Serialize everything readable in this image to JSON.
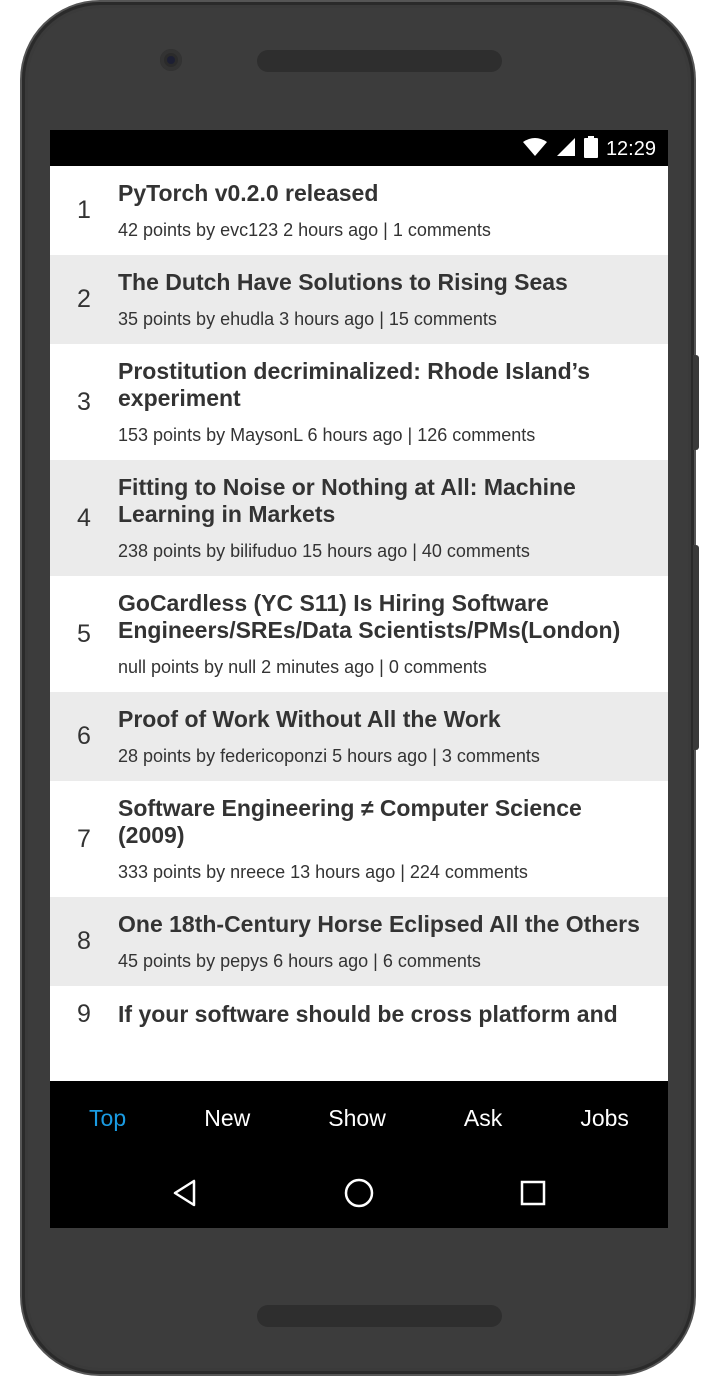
{
  "status_bar": {
    "time": "12:29",
    "icons": [
      "wifi-icon",
      "cell-signal-icon",
      "battery-icon"
    ]
  },
  "stories": [
    {
      "rank": "1",
      "title": "PyTorch v0.2.0 released",
      "meta": "42 points by evc123 2 hours ago | 1 comments"
    },
    {
      "rank": "2",
      "title": "The Dutch Have Solutions to Rising Seas",
      "meta": "35 points by ehudla 3 hours ago | 15 comments"
    },
    {
      "rank": "3",
      "title": "Prostitution decriminalized: Rhode Island’s experiment",
      "meta": "153 points by MaysonL 6 hours ago | 126 comments"
    },
    {
      "rank": "4",
      "title": "Fitting to Noise or Nothing at All: Machine Learning in Markets",
      "meta": "238 points by bilifuduo 15 hours ago | 40 comments"
    },
    {
      "rank": "5",
      "title": "GoCardless (YC S11) Is Hiring Software Engineers/SREs/Data Scientists/PMs(London)",
      "meta": "null points by null 2 minutes ago | 0 comments"
    },
    {
      "rank": "6",
      "title": "Proof of Work Without All the Work",
      "meta": "28 points by federicoponzi 5 hours ago | 3 comments"
    },
    {
      "rank": "7",
      "title": "Software Engineering ≠ Computer Science (2009)",
      "meta": "333 points by nreece 13 hours ago | 224 comments"
    },
    {
      "rank": "8",
      "title": "One 18th-Century Horse Eclipsed All the Others",
      "meta": "45 points by pepys 6 hours ago | 6 comments"
    },
    {
      "rank": "9",
      "title": "If your software should be cross platform and",
      "meta": ""
    }
  ],
  "tabs": [
    {
      "label": "Top",
      "active": true
    },
    {
      "label": "New",
      "active": false
    },
    {
      "label": "Show",
      "active": false
    },
    {
      "label": "Ask",
      "active": false
    },
    {
      "label": "Jobs",
      "active": false
    }
  ],
  "nav_buttons": [
    "back-icon",
    "home-icon",
    "recents-icon"
  ],
  "colors": {
    "active_tab": "#1a9be2",
    "alt_row": "#ebebeb",
    "bar_bg": "#000000",
    "text": "#333333"
  }
}
